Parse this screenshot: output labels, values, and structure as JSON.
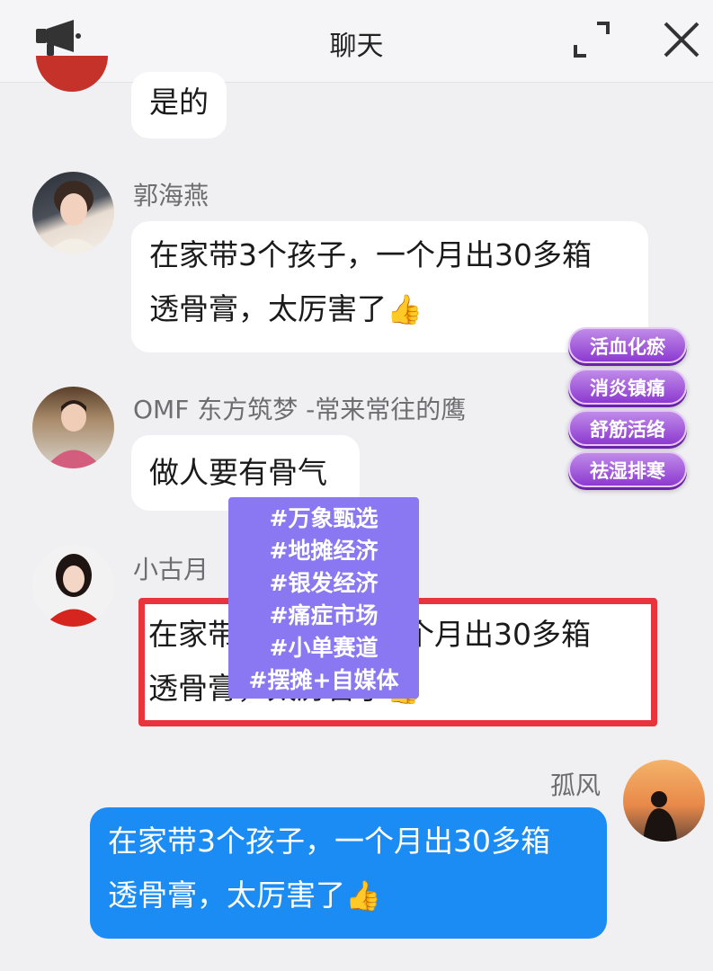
{
  "header": {
    "title": "聊天",
    "left_icon": "megaphone-icon",
    "expand_icon": "expand-icon",
    "close_icon": "close-icon"
  },
  "messages": [
    {
      "name": "",
      "text": "是的"
    },
    {
      "name": "郭海燕",
      "line1": "在家带3个孩子，一个月出30多箱",
      "line2": "透骨膏，太厉害了"
    },
    {
      "name": "OMF 东方筑梦 -常来常往的鹰",
      "text": "做人要有骨气"
    },
    {
      "name": "小古月",
      "line1": "在家带3个孩子，一个月出30多箱",
      "line2": "透骨膏，太厉害了"
    },
    {
      "name": "孤风",
      "line1": "在家带3个孩子，一个月出30多箱",
      "line2": "透骨膏，太厉害了"
    }
  ],
  "emoji": "👍",
  "side_tags": [
    "活血化瘀",
    "消炎镇痛",
    "舒筋活络",
    "祛湿排寒"
  ],
  "hashtags": [
    "#万象甄选",
    "#地摊经济",
    "#银发经济",
    "#痛症市场",
    "#小单赛道",
    "#摆摊+自媒体"
  ],
  "colors": {
    "my_bubble": "#1c8cf5",
    "highlight_frame": "#e8343b",
    "hashtag_box": "#8a77f2",
    "pill": "#9b4fd8"
  }
}
